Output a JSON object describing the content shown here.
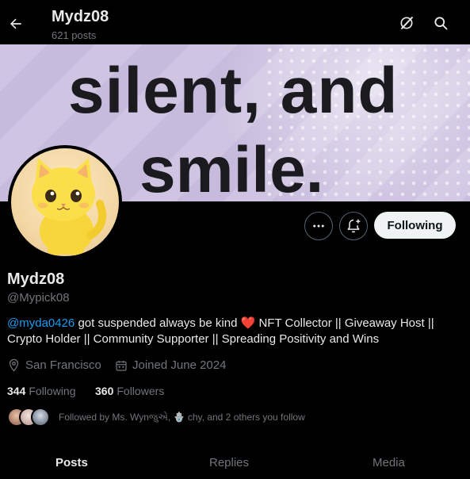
{
  "header": {
    "title": "Mydz08",
    "posts_count": "621 posts",
    "back_icon": "arrow-left-icon",
    "grok_icon": "grok-icon",
    "search_icon": "search-icon"
  },
  "banner": {
    "line1": "silent, and",
    "line2": "smile."
  },
  "actions": {
    "more_icon": "more-icon",
    "notify_icon": "bell-plus-icon",
    "follow_label": "Following"
  },
  "profile": {
    "name": "Mydz08",
    "handle": "@Mypick08",
    "bio_mention": "@myda0426",
    "bio_part1": " got suspended always be kind ",
    "bio_heart": "❤️",
    "bio_part2": " NFT Collector || Giveaway Host || Crypto Holder || Community Supporter || Spreading Positivity and Wins",
    "location": "San Francisco",
    "joined": "Joined June 2024",
    "following_count": "344",
    "following_label": "Following",
    "followers_count": "360",
    "followers_label": "Followers",
    "followed_by": "Followed by Ms. Wynજુએ, 🪬 chy, and 2 others you follow"
  },
  "tabs": [
    "Posts",
    "Replies",
    "Media"
  ],
  "colors": {
    "accent": "#1d9bf0",
    "heart": "#f91880",
    "muted": "#71767b",
    "text": "#e7e9ea"
  }
}
